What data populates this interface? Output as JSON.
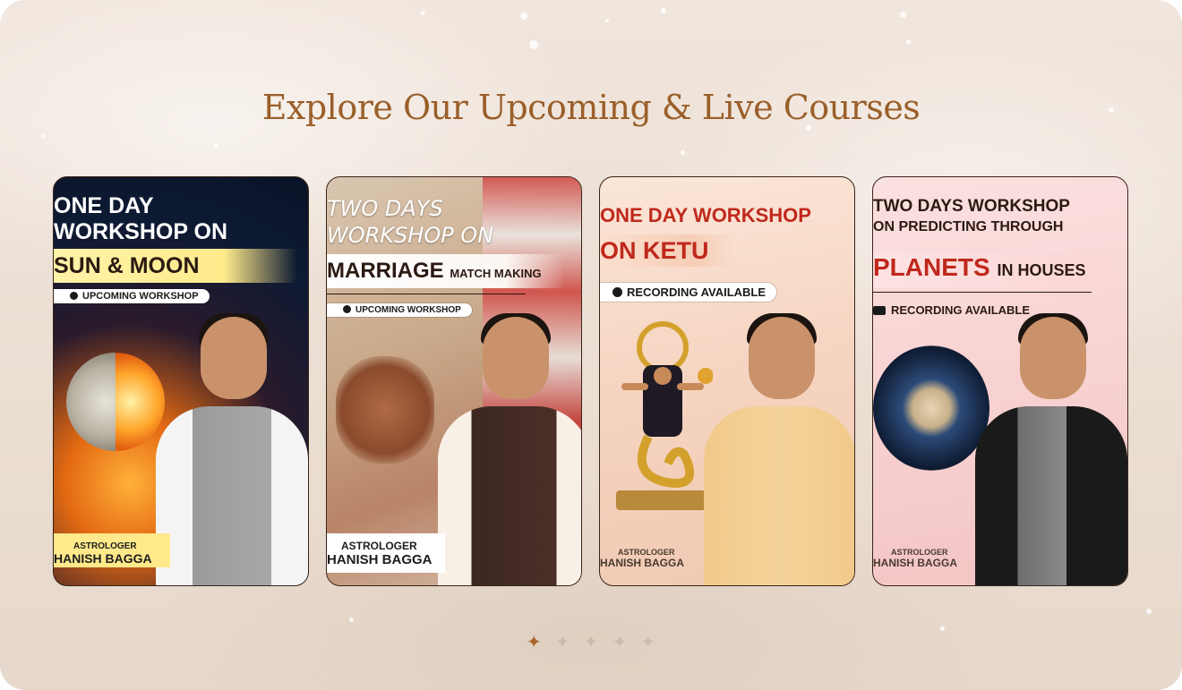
{
  "section": {
    "title": "Explore Our Upcoming & Live Courses"
  },
  "cards": [
    {
      "headline_lines": [
        "ONE DAY",
        "WORKSHOP ON"
      ],
      "topic": "SUN & MOON",
      "badge": "UPCOMING WORKSHOP",
      "signature_line1": "ASTROLOGER",
      "signature_line2": "HANISH BAGGA"
    },
    {
      "headline_lines": [
        "TWO DAYS",
        "WORKSHOP ON"
      ],
      "topic": "MARRIAGE",
      "topic_suffix": "MATCH MAKING",
      "badge": "UPCOMING WORKSHOP",
      "signature_line1": "ASTROLOGER",
      "signature_line2": "HANISH BAGGA"
    },
    {
      "headline_lines": [
        "ONE DAY WORKSHOP"
      ],
      "topic": "ON KETU",
      "badge": "RECORDING AVAILABLE",
      "signature_line1": "ASTROLOGER",
      "signature_line2": "HANISH BAGGA"
    },
    {
      "headline_lines": [
        "TWO DAYS WORKSHOP",
        "ON PREDICTING THROUGH"
      ],
      "topic": "PLANETS",
      "topic_suffix": "IN HOUSES",
      "badge": "RECORDING AVAILABLE",
      "signature_line1": "ASTROLOGER",
      "signature_line2": "HANISH BAGGA"
    }
  ],
  "pagination": {
    "count": 5,
    "active_index": 0,
    "glyph": "✦"
  },
  "colors": {
    "title": "#9a5f2a",
    "active_dot": "#a8622c",
    "inactive_dot": "#c9bcae"
  },
  "icons": {
    "pagination": "four-point-star-icon",
    "badge_upcoming": "refresh-icon",
    "badge_recording": "video-camera-icon"
  }
}
